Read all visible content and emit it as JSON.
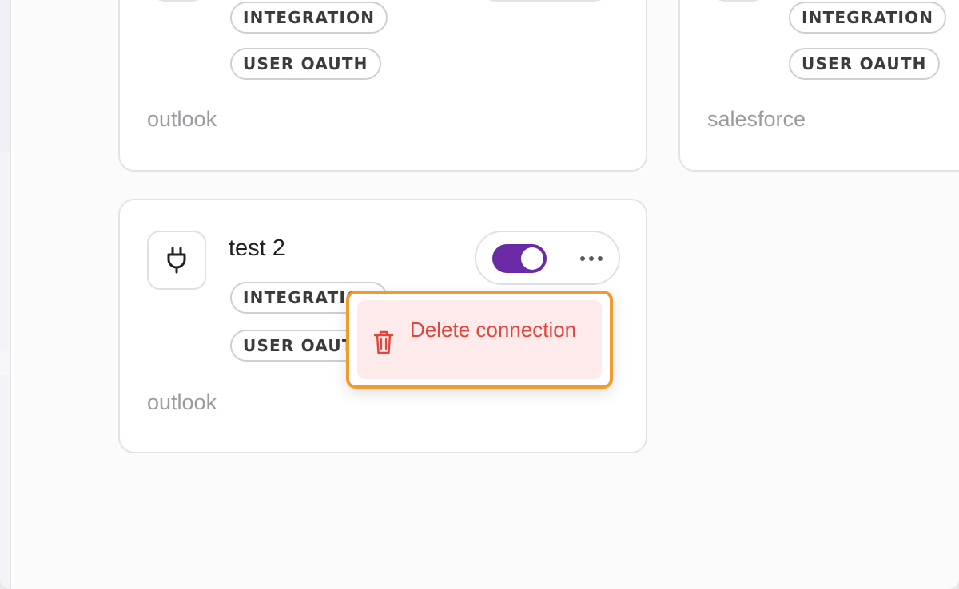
{
  "cards": [
    {
      "tags": [
        "INTEGRATION",
        "USER OAUTH"
      ],
      "provider": "outlook"
    },
    {
      "tags": [
        "INTEGRATION",
        "USER OAUTH"
      ],
      "provider": "salesforce"
    },
    {
      "icon": "plug-icon",
      "title": "test 2",
      "tags": [
        "INTEGRATION",
        "USER OAUTH"
      ],
      "provider": "outlook",
      "enabled": true
    }
  ],
  "context_menu": {
    "delete_label": "Delete connection",
    "icon": "trash-icon"
  },
  "colors": {
    "toggle_on": "#6a2aa6",
    "danger_text": "#e2453c",
    "danger_bg": "#fdeaea",
    "highlight": "#f09a30"
  }
}
